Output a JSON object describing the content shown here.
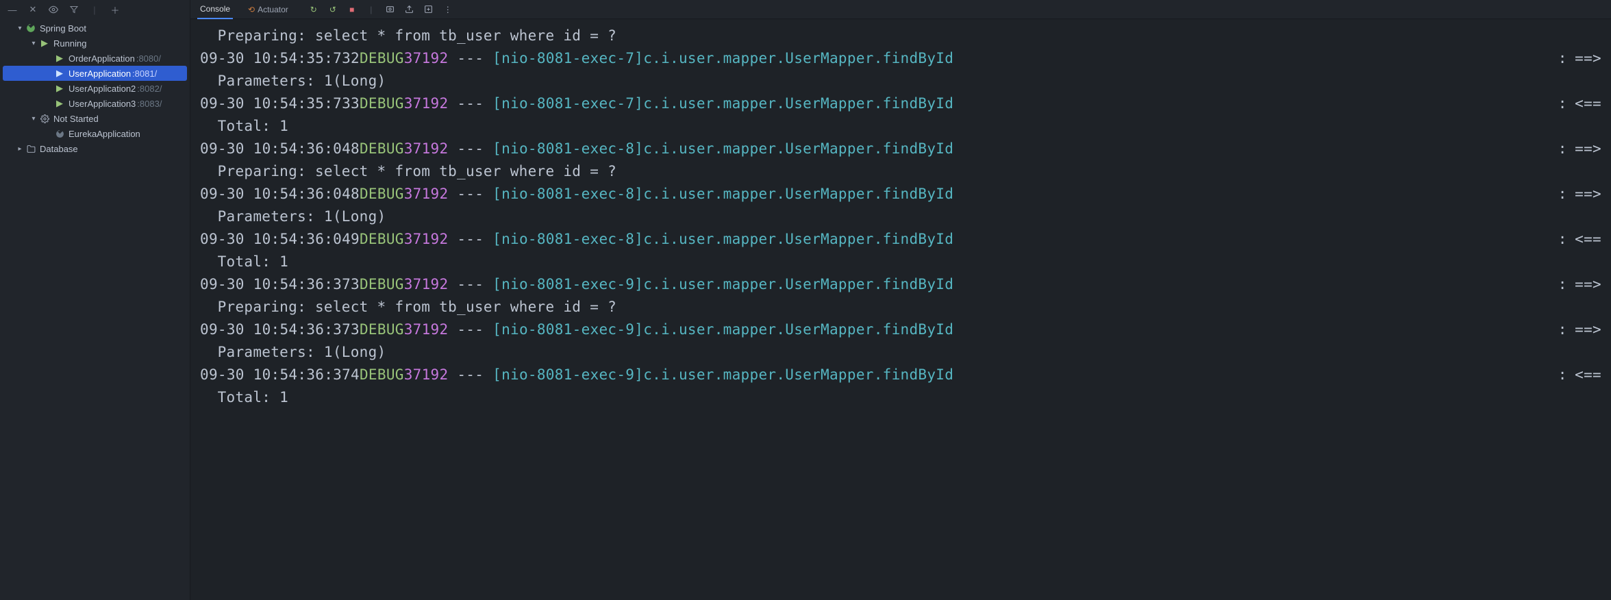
{
  "sidebar": {
    "root": "Spring Boot",
    "running_label": "Running",
    "not_started_label": "Not Started",
    "db_label": "Database",
    "apps": [
      {
        "name": "OrderApplication",
        "port": ":8080/"
      },
      {
        "name": "UserApplication",
        "port": ":8081/"
      },
      {
        "name": "UserApplication2",
        "port": ":8082/"
      },
      {
        "name": "UserApplication3",
        "port": ":8083/"
      }
    ],
    "not_started_apps": [
      {
        "name": "EurekaApplication"
      }
    ]
  },
  "tabs": {
    "console": "Console",
    "actuator": "Actuator"
  },
  "log": [
    {
      "type": "cont",
      "text": " Preparing: select * from tb_user where id = ?"
    },
    {
      "type": "line",
      "ts": "09-30 10:54:35:732",
      "level": "DEBUG",
      "pid": "37192",
      "thread": "[nio-8081-exec-7]",
      "logger": "c.i.user.mapper.UserMapper.findById",
      "arrow": "==>"
    },
    {
      "type": "cont",
      "text": " Parameters: 1(Long)"
    },
    {
      "type": "line",
      "ts": "09-30 10:54:35:733",
      "level": "DEBUG",
      "pid": "37192",
      "thread": "[nio-8081-exec-7]",
      "logger": "c.i.user.mapper.UserMapper.findById",
      "arrow": "<=="
    },
    {
      "type": "cont",
      "text": " Total: 1"
    },
    {
      "type": "line",
      "ts": "09-30 10:54:36:048",
      "level": "DEBUG",
      "pid": "37192",
      "thread": "[nio-8081-exec-8]",
      "logger": "c.i.user.mapper.UserMapper.findById",
      "arrow": "==>"
    },
    {
      "type": "cont",
      "text": " Preparing: select * from tb_user where id = ?"
    },
    {
      "type": "line",
      "ts": "09-30 10:54:36:048",
      "level": "DEBUG",
      "pid": "37192",
      "thread": "[nio-8081-exec-8]",
      "logger": "c.i.user.mapper.UserMapper.findById",
      "arrow": "==>"
    },
    {
      "type": "cont",
      "text": " Parameters: 1(Long)"
    },
    {
      "type": "line",
      "ts": "09-30 10:54:36:049",
      "level": "DEBUG",
      "pid": "37192",
      "thread": "[nio-8081-exec-8]",
      "logger": "c.i.user.mapper.UserMapper.findById",
      "arrow": "<=="
    },
    {
      "type": "cont",
      "text": " Total: 1"
    },
    {
      "type": "line",
      "ts": "09-30 10:54:36:373",
      "level": "DEBUG",
      "pid": "37192",
      "thread": "[nio-8081-exec-9]",
      "logger": "c.i.user.mapper.UserMapper.findById",
      "arrow": "==>"
    },
    {
      "type": "cont",
      "text": " Preparing: select * from tb_user where id = ?"
    },
    {
      "type": "line",
      "ts": "09-30 10:54:36:373",
      "level": "DEBUG",
      "pid": "37192",
      "thread": "[nio-8081-exec-9]",
      "logger": "c.i.user.mapper.UserMapper.findById",
      "arrow": "==>"
    },
    {
      "type": "cont",
      "text": " Parameters: 1(Long)"
    },
    {
      "type": "line",
      "ts": "09-30 10:54:36:374",
      "level": "DEBUG",
      "pid": "37192",
      "thread": "[nio-8081-exec-9]",
      "logger": "c.i.user.mapper.UserMapper.findById",
      "arrow": "<=="
    },
    {
      "type": "cont",
      "text": " Total: 1"
    }
  ]
}
